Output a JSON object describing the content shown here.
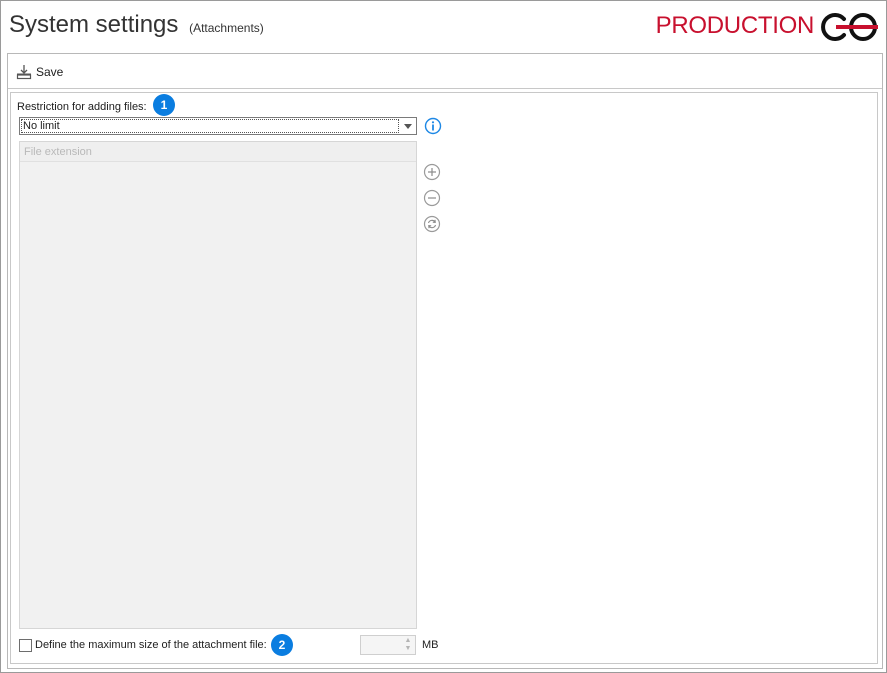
{
  "header": {
    "title": "System settings",
    "subtitle": "(Attachments)",
    "environment": "PRODUCTION",
    "environment_color": "#c8102e"
  },
  "toolbar": {
    "save_label": "Save",
    "save_icon": "save-icon"
  },
  "restriction": {
    "label": "Restriction for adding files:",
    "badge": "1",
    "selected": "No limit",
    "info_icon": "info-icon"
  },
  "grid": {
    "column_header": "File extension",
    "rows": []
  },
  "side_buttons": {
    "add_icon": "plus-circle-icon",
    "remove_icon": "minus-circle-icon",
    "refresh_icon": "refresh-icon"
  },
  "max_size": {
    "checkbox_label": "Define the maximum size of the attachment file:",
    "checked": false,
    "badge": "2",
    "value": "",
    "unit": "MB"
  },
  "colors": {
    "badge": "#0a7de0",
    "info": "#1e88e5"
  }
}
